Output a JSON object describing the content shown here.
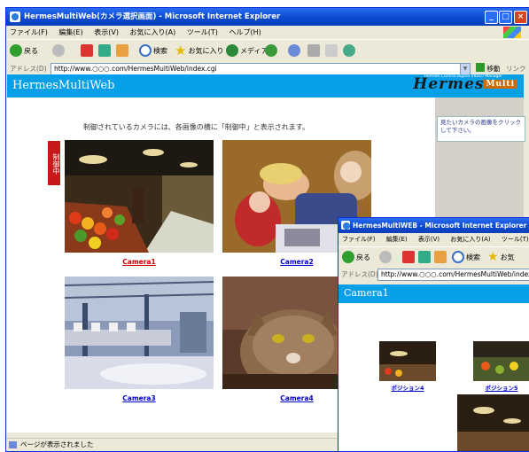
{
  "main_window": {
    "title": "HermesMultiWeb(カメラ選択画面) - Microsoft Internet Explorer",
    "menu": [
      "ファイル(F)",
      "編集(E)",
      "表示(V)",
      "お気に入り(A)",
      "ツール(T)",
      "ヘルプ(H)"
    ],
    "toolbar": {
      "back": "戻る",
      "search": "検索",
      "favorites": "お気に入り",
      "media": "メディア"
    },
    "address_label": "アドレス(D)",
    "address": "http://www.○○○.com/HermesMultiWeb/index.cgi",
    "go_label": "移動",
    "links_label": "リンク",
    "status": "ページが表示されました"
  },
  "site": {
    "title": "HermesMultiWeb",
    "logo": "Hermes",
    "logo_badge": "Multi",
    "logo_tagline": "Remote Control Digital VIDEO Manager",
    "notice": "制御されているカメラには、各画像の横に「制御中」と表示されます。",
    "tip": "見たいカメラの画像をクリックして下さい。",
    "controlling_badge": "制御中",
    "cameras": [
      "Camera1",
      "Camera2",
      "Camera3",
      "Camera4"
    ]
  },
  "popup_window": {
    "title": "HermesMultiWEB - Microsoft Internet Explorer",
    "menu": [
      "ファイル(F)",
      "編集(E)",
      "表示(V)",
      "お気に入り(A)",
      "ツール(T)",
      "ヘ"
    ],
    "toolbar": {
      "back": "戻る",
      "search": "検索",
      "favorites": "お気"
    },
    "address_label": "アドレス(D)",
    "address": "http://www.○○○.com/HermesMultiWeb/index.cgi",
    "page_title": "Camera1",
    "positions": [
      "ポジション4",
      "ポジション5"
    ]
  },
  "colors": {
    "header_blue": "#079fe8",
    "title_bar": "#0a4ad0",
    "badge_red": "#c81818",
    "link": "#0000cc",
    "active_link": "#cc0000"
  }
}
